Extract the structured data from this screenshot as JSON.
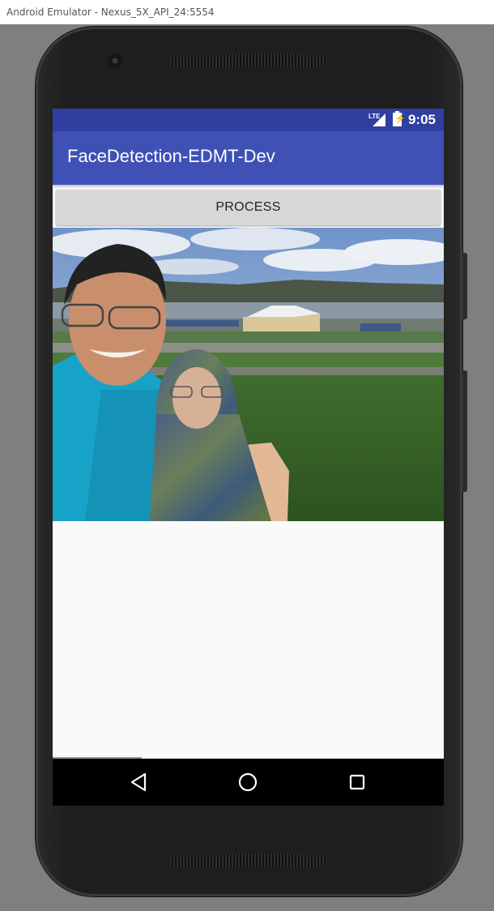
{
  "window": {
    "title": "Android Emulator - Nexus_5X_API_24:5554"
  },
  "status_bar": {
    "time": "9:05",
    "network": "LTE",
    "color": "#303f9f"
  },
  "app_bar": {
    "title": "FaceDetection-EDMT-Dev",
    "color": "#3f51b5"
  },
  "main": {
    "process_button": "PROCESS",
    "image": "selfie photo of two people outdoors by a lake"
  },
  "nav_bar": {
    "back": "back-icon",
    "home": "home-icon",
    "recents": "recents-icon"
  }
}
